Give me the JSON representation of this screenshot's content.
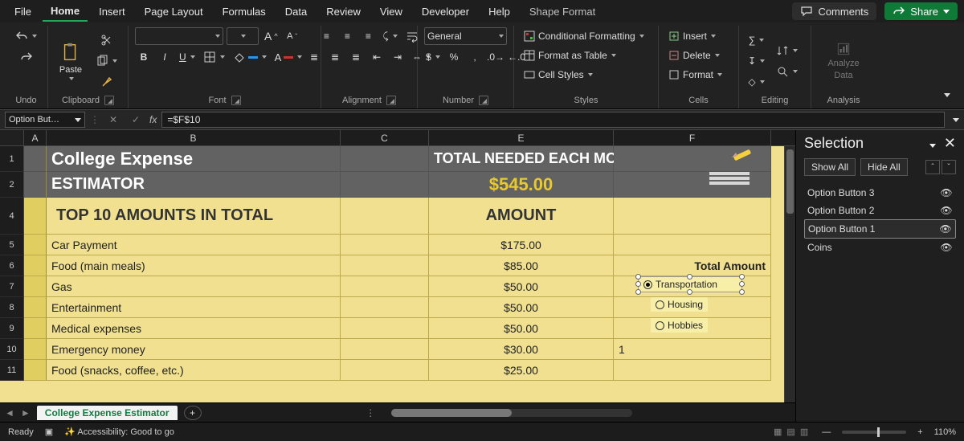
{
  "tabs": {
    "file": "File",
    "home": "Home",
    "insert": "Insert",
    "page_layout": "Page Layout",
    "formulas": "Formulas",
    "data": "Data",
    "review": "Review",
    "view": "View",
    "developer": "Developer",
    "help": "Help",
    "shape_format": "Shape Format"
  },
  "topright": {
    "comments": "Comments",
    "share": "Share"
  },
  "ribbon": {
    "undo": {
      "label": "Undo"
    },
    "clipboard": {
      "label": "Clipboard",
      "paste": "Paste"
    },
    "font": {
      "label": "Font",
      "bold": "B",
      "italic": "I",
      "underline": "U",
      "size_up": "A",
      "size_down": "A"
    },
    "alignment": {
      "label": "Alignment"
    },
    "number": {
      "label": "Number",
      "format": "General",
      "currency": "$",
      "percent": "%",
      "comma": ","
    },
    "styles": {
      "label": "Styles",
      "cond": "Conditional Formatting",
      "table": "Format as Table",
      "cell": "Cell Styles"
    },
    "cells": {
      "label": "Cells",
      "insert": "Insert",
      "delete": "Delete",
      "format": "Format"
    },
    "editing": {
      "label": "Editing"
    },
    "analysis": {
      "label": "Analysis",
      "analyze": "Analyze",
      "data": "Data"
    }
  },
  "formula": {
    "namebox": "Option But…",
    "value": "=$F$10",
    "fx": "fx"
  },
  "cols": {
    "A": "A",
    "B": "B",
    "C": "C",
    "E": "E",
    "F": "F"
  },
  "rows": {
    "1": "1",
    "2": "2",
    "4": "4",
    "5": "5",
    "6": "6",
    "7": "7",
    "8": "8",
    "9": "9",
    "10": "10",
    "11": "11"
  },
  "sheet": {
    "title1": "College Expense",
    "title2": "ESTIMATOR",
    "total_label": "TOTAL NEEDED EACH MONTH:",
    "total_value": "$545.00",
    "sub_label": "TOP 10 AMOUNTS IN TOTAL",
    "sub_amount": "AMOUNT",
    "f_total": "Total Amount",
    "rows": [
      {
        "n": "5",
        "label": "Car Payment",
        "amount": "$175.00"
      },
      {
        "n": "6",
        "label": "Food (main meals)",
        "amount": "$85.00"
      },
      {
        "n": "7",
        "label": "Gas",
        "amount": "$50.00"
      },
      {
        "n": "8",
        "label": "Entertainment",
        "amount": "$50.00"
      },
      {
        "n": "9",
        "label": "Medical expenses",
        "amount": "$50.00"
      },
      {
        "n": "10",
        "label": "Emergency money",
        "amount": "$30.00",
        "f": "1"
      },
      {
        "n": "11",
        "label": "Food (snacks, coffee, etc.)",
        "amount": "$25.00"
      }
    ],
    "opts": {
      "transport": "Transportation",
      "housing": "Housing",
      "hobbies": "Hobbies"
    }
  },
  "tabs_sheet": {
    "name": "College Expense Estimator"
  },
  "selpane": {
    "title": "Selection",
    "show": "Show All",
    "hide": "Hide All",
    "items": [
      {
        "label": "Option Button 3"
      },
      {
        "label": "Option Button 2"
      },
      {
        "label": "Option Button 1",
        "selected": true
      },
      {
        "label": "Coins"
      }
    ]
  },
  "status": {
    "ready": "Ready",
    "access": "Accessibility: Good to go",
    "zoom": "110%"
  }
}
